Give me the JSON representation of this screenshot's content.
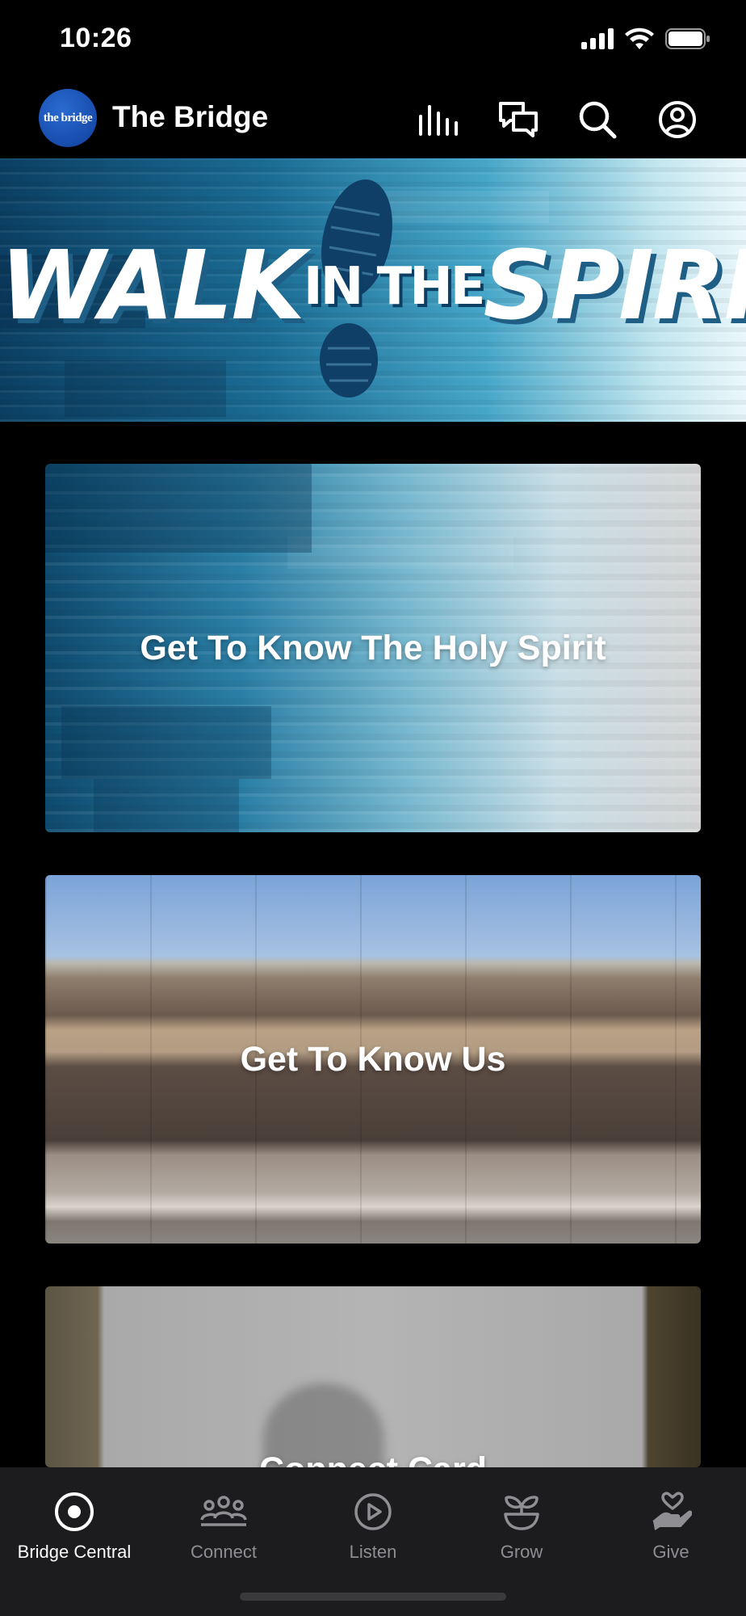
{
  "status_bar": {
    "time": "10:26",
    "icons": [
      "signal-icon",
      "wifi-icon",
      "battery-icon"
    ]
  },
  "header": {
    "logo_text": "the bridge",
    "title": "The Bridge",
    "actions": [
      "equalizer-icon",
      "chat-icon",
      "search-icon",
      "account-icon"
    ]
  },
  "hero": {
    "word1": "WALK",
    "word2": "IN THE",
    "word3": "SPIRIT",
    "colors": {
      "dark": "#0b3f63",
      "light": "#eaf7fb"
    }
  },
  "cards": [
    {
      "title": "Get To Know The Holy Spirit"
    },
    {
      "title": "Get To Know Us"
    },
    {
      "title": "Connect Card"
    }
  ],
  "tabbar": {
    "items": [
      {
        "label": "Bridge Central",
        "icon": "target-icon",
        "active": true
      },
      {
        "label": "Connect",
        "icon": "group-icon",
        "active": false
      },
      {
        "label": "Listen",
        "icon": "play-icon",
        "active": false
      },
      {
        "label": "Grow",
        "icon": "plant-icon",
        "active": false
      },
      {
        "label": "Give",
        "icon": "heart-hand-icon",
        "active": false
      }
    ]
  },
  "accent": "#ffffff",
  "inactive": "#8e8e93"
}
